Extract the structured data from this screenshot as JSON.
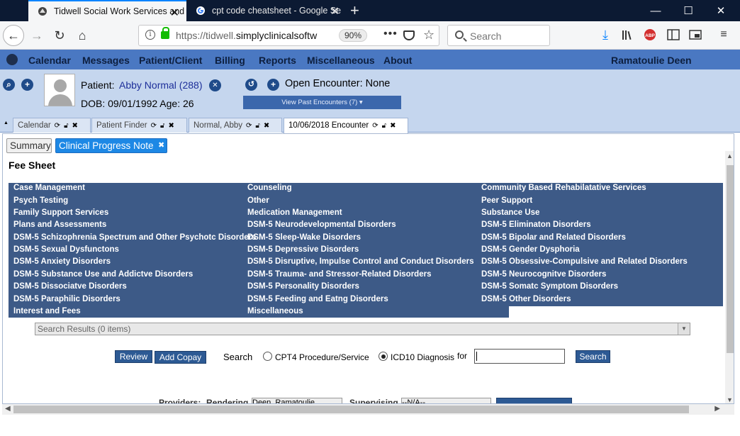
{
  "browser": {
    "tabs": [
      {
        "title": "Tidwell Social Work Services and",
        "active": true
      },
      {
        "title": "cpt code cheatsheet - Google Se",
        "active": false
      }
    ],
    "new_tab": "+",
    "url_host_prefix": "https://tidwell.",
    "url_host_main": "simplyclinicalsoftw",
    "zoom": "90%",
    "search_placeholder": "Search",
    "colors": {
      "tabstrip": "#0c1a33",
      "active_tab_accent": "#0a84ff"
    }
  },
  "menu": {
    "items": [
      "Calendar",
      "Messages",
      "Patient/Client",
      "Billing",
      "Reports",
      "Miscellaneous",
      "About"
    ],
    "user": "Ramatoulie Deen",
    "color": "#4a78c2"
  },
  "patient": {
    "label": "Patient:",
    "name": "Abby Normal (288)",
    "dob": "DOB: 09/01/1992 Age: 26",
    "encounter": "Open Encounter: None",
    "view_past": "View Past Encounters  (7) ▾"
  },
  "app_tabs": [
    {
      "label": "Calendar"
    },
    {
      "label": "Patient Finder"
    },
    {
      "label": "Normal, Abby"
    },
    {
      "label": "10/06/2018 Encounter",
      "active": true
    }
  ],
  "sub_tabs": {
    "summary": "Summary",
    "cpn": "Clinical Progress Note"
  },
  "fee_sheet": {
    "title": "Fee Sheet",
    "columns": [
      [
        "Case Management",
        "Psych Testing",
        "Family Support Services",
        "Plans and Assessments",
        "DSM-5 Schizophrenia Spectrum and Other Psychotc Disorders",
        "DSM-5 Sexual Dysfunctons",
        "DSM-5 Anxiety Disorders",
        "DSM-5 Substance Use and Addictve Disorders",
        "DSM-5 Dissociatve Disorders",
        "DSM-5 Paraphilic Disorders",
        "Interest and Fees"
      ],
      [
        "Counseling",
        "Other",
        "Medication Management",
        "DSM-5 Neurodevelopmental Disorders",
        "DSM-5 Sleep-Wake Disorders",
        "DSM-5 Depressive Disorders",
        "DSM-5 Disruptive, Impulse Control and Conduct Disorders",
        "DSM-5 Trauma- and Stressor-Related Disorders",
        "DSM-5 Personality Disorders",
        "DSM-5 Feeding and Eatng Disorders",
        "Miscellaneous"
      ],
      [
        "Community Based Rehabilatative Services",
        "Peer Support",
        "Substance Use",
        "DSM-5 Eliminaton Disorders",
        "DSM-5 Bipolar and Related Disorders",
        "DSM-5 Gender Dysphoria",
        "DSM-5 Obsessive-Compulsive and Related Disorders",
        "DSM-5 Neurocognitve Disorders",
        "DSM-5 Somatc Symptom Disorders",
        "DSM-5 Other Disorders"
      ]
    ],
    "search_results": "Search Results (0 items)",
    "review": "Review",
    "add_copay": "Add Copay",
    "search_label": "Search",
    "cpt_label": "CPT4 Procedure/Service",
    "icd_label": "ICD10 Diagnosis",
    "for_label": "for",
    "search_button": "Search",
    "partial_row": {
      "providers": "Providers:",
      "rendering": "Rendering",
      "rendering_value": "Deen, Ramatoulie",
      "supervising": "Supervising",
      "supervising_value": "--N/A--"
    }
  }
}
